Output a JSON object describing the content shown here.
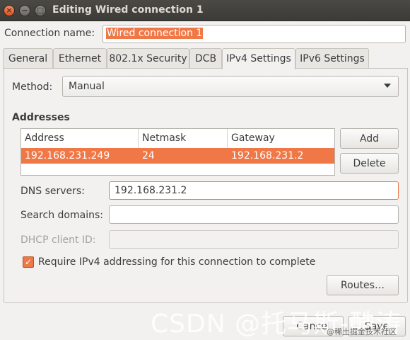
{
  "window": {
    "title": "Editing Wired connection 1",
    "close_glyph": "×",
    "min_glyph": "−",
    "max_glyph": "□"
  },
  "connection": {
    "label": "Connection name:",
    "value": "Wired connection 1"
  },
  "tabs": [
    {
      "label": "General"
    },
    {
      "label": "Ethernet"
    },
    {
      "label": "802.1x Security"
    },
    {
      "label": "DCB"
    },
    {
      "label": "IPv4 Settings",
      "active": true
    },
    {
      "label": "IPv6 Settings"
    }
  ],
  "method": {
    "label": "Method:",
    "value": "Manual"
  },
  "addresses": {
    "heading": "Addresses",
    "columns": [
      "Address",
      "Netmask",
      "Gateway"
    ],
    "rows": [
      {
        "address": "192.168.231.249",
        "netmask": "24",
        "gateway": "192.168.231.2"
      }
    ],
    "add_label": "Add",
    "delete_label": "Delete"
  },
  "dns": {
    "label": "DNS servers:",
    "value": "192.168.231.2"
  },
  "search_domains": {
    "label": "Search domains:",
    "value": ""
  },
  "dhcp_client_id": {
    "label": "DHCP client ID:",
    "value": ""
  },
  "require_ipv4": {
    "label": "Require IPv4 addressing for this connection to complete",
    "checked": true
  },
  "routes_label": "Routes…",
  "footer": {
    "cancel_label": "Cancel",
    "save_label": "Save"
  },
  "watermark": {
    "main": "CSDN @托马斯-酷涛",
    "sub": "@稀土掘金技术社区"
  },
  "colors": {
    "accent": "#f07746",
    "titlebar": "#3c3b37",
    "background": "#f2f1f0"
  }
}
